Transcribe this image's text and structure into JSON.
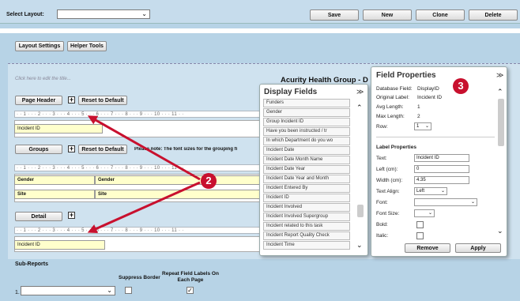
{
  "toolbar": {
    "select_layout_label": "Select Layout:",
    "save": "Save",
    "new": "New",
    "clone": "Clone",
    "delete": "Delete"
  },
  "settings": {
    "layout_settings": "Layout Settings",
    "helper_tools": "Helper Tools"
  },
  "designer": {
    "title_placeholder": "Click here to edit the title...",
    "org_title": "Acurity Health Group - D",
    "page_header": {
      "label": "Page Header",
      "reset": "Reset to Default",
      "field": "Incident ID"
    },
    "groups": {
      "label": "Groups",
      "reset": "Reset to Default",
      "note": "Please note: The font sizes for the grouping fi",
      "row1_col1": "Gender",
      "row1_col2": "Gender",
      "row2_col1": "Site",
      "row2_col2": "Site"
    },
    "detail": {
      "label": "Detail",
      "field": "Incident ID"
    },
    "ruler": "· · 1 · · · 2 · · · 3 · · · 4 · · · 5 · · · 6 · · · 7 · · · 8 · · · 9 · · · 10 · · · 11 · ·",
    "plus": "+"
  },
  "subreports": {
    "title": "Sub-Reports",
    "col_suppress": "Suppress Border",
    "col_repeat": "Repeat Field Labels On Each Page",
    "row_number": "1.",
    "check": "✓"
  },
  "display_fields": {
    "title": "Display Fields",
    "items": [
      "Funders",
      "Gender",
      "Group Incident ID",
      "Have you been instructed / tr",
      "In which Department do you wo",
      "Incident Date",
      "Incident Date Month Name",
      "Incident Date Year",
      "Incident Date Year and Month",
      "Incident Entered By",
      "Incident ID",
      "Incident Involved",
      "Incident Involved Supergroup",
      "Incident related to this task",
      "Incident Report Quality Check",
      "Incident Time"
    ]
  },
  "field_properties": {
    "title": "Field Properties",
    "database_field_label": "Database Field:",
    "database_field": "DisplayID",
    "original_label_label": "Original Label:",
    "original_label": "Incident ID",
    "avg_length_label": "Avg Length:",
    "avg_length": "1",
    "max_length_label": "Max Length:",
    "max_length": "2",
    "row_label": "Row:",
    "row_value": "1",
    "label_properties": "Label Properties",
    "text_label": "Text:",
    "text_value": "Incident ID",
    "left_label": "Left (cm):",
    "left_value": "0",
    "width_label": "Width (cm):",
    "width_value": "4.35",
    "text_align_label": "Text Align:",
    "text_align_value": "Left",
    "font_label": "Font:",
    "font_size_label": "Font Size:",
    "bold_label": "Bold:",
    "italic_label": "Italic:",
    "remove": "Remove",
    "apply": "Apply"
  },
  "callouts": {
    "two": "2",
    "three": "3"
  },
  "colors": {
    "background": "#b7d3e6",
    "field_yellow": "#ffffcc",
    "callout_red": "#c8102e"
  }
}
